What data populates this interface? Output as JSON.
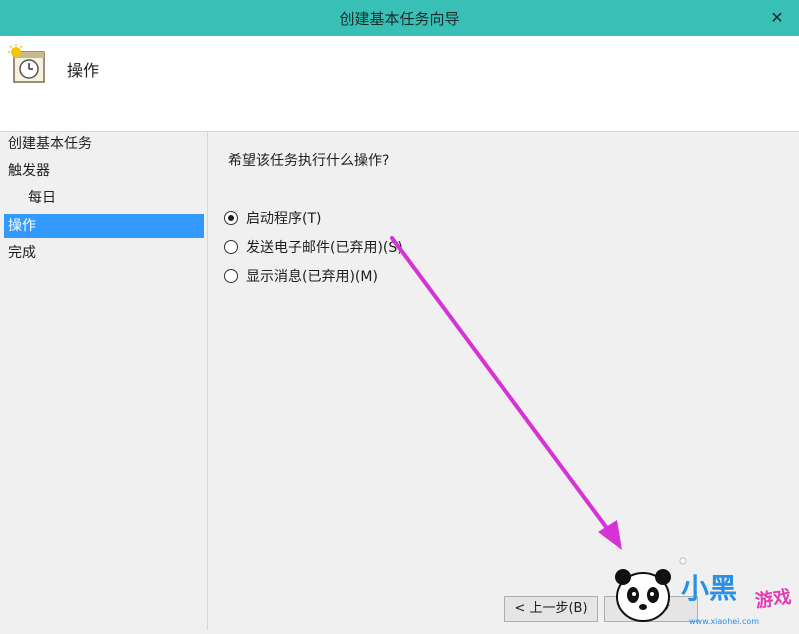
{
  "window": {
    "title": "创建基本任务向导",
    "close_glyph": "✕"
  },
  "header": {
    "title": "操作",
    "icon": "task-clock-icon"
  },
  "sidebar": {
    "items": [
      {
        "label": "创建基本任务"
      },
      {
        "label": "触发器"
      },
      {
        "label": "每日"
      },
      {
        "label": "操作"
      },
      {
        "label": "完成"
      }
    ]
  },
  "main": {
    "question": "希望该任务执行什么操作?",
    "options": [
      {
        "label": "启动程序(T)",
        "checked": true
      },
      {
        "label": "发送电子邮件(已弃用)(S)",
        "checked": false
      },
      {
        "label": "显示消息(已弃用)(M)",
        "checked": false
      }
    ]
  },
  "footer": {
    "back_label": "< 上一步(B)",
    "next_label_partial": "下一步"
  },
  "annotation": {
    "arrow_color": "#d633d6"
  },
  "watermark": {
    "brand_cn": "小黑",
    "brand_game": "游戏",
    "url": "www.xiaohei.com"
  },
  "colors": {
    "titlebar": "#38c0b6",
    "selection": "#3399ff"
  }
}
